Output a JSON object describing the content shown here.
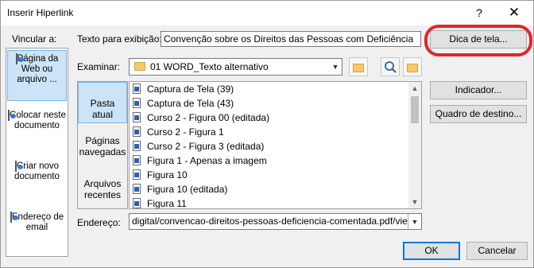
{
  "window": {
    "title": "Inserir Hiperlink",
    "help_label": "?",
    "close_label": "✕"
  },
  "link_to": {
    "label": "Vincular a:",
    "items": [
      {
        "label": "Página da Web ou arquivo ...",
        "selected": true
      },
      {
        "label": "Colocar neste documento"
      },
      {
        "label": "Criar novo documento"
      },
      {
        "label": "Endereço de email"
      }
    ]
  },
  "display_text": {
    "label": "Texto para exibição:",
    "value": "Convenção sobre os Direitos das Pessoas com Deficiência"
  },
  "screen_tip_button": "Dica de tela...",
  "look_in": {
    "label": "Examinar:",
    "value": "01 WORD_Texto alternativo"
  },
  "side_nav": [
    {
      "label": "Pasta atual",
      "selected": true
    },
    {
      "label": "Páginas navegadas"
    },
    {
      "label": "Arquivos recentes"
    }
  ],
  "files": [
    "Captura de Tela (39)",
    "Captura de Tela (43)",
    "Curso 2 - Figura 00 (editada)",
    "Curso 2 - Figura 1",
    "Curso 2 - Figura 3 (editada)",
    "Figura 1 - Apenas a imagem",
    "Figura 10",
    "Figura 10 (editada)",
    "Figura 11"
  ],
  "bookmark_button": "Indicador...",
  "target_frame_button": "Quadro de destino...",
  "address": {
    "label": "Endereço:",
    "value": "digital/convencao-direitos-pessoas-deficiencia-comentada.pdf/view"
  },
  "ok_button": "OK",
  "cancel_button": "Cancelar",
  "colors": {
    "selection": "#cce4f7",
    "highlight_ring": "#e0262b",
    "default_button_border": "#0078d7"
  }
}
